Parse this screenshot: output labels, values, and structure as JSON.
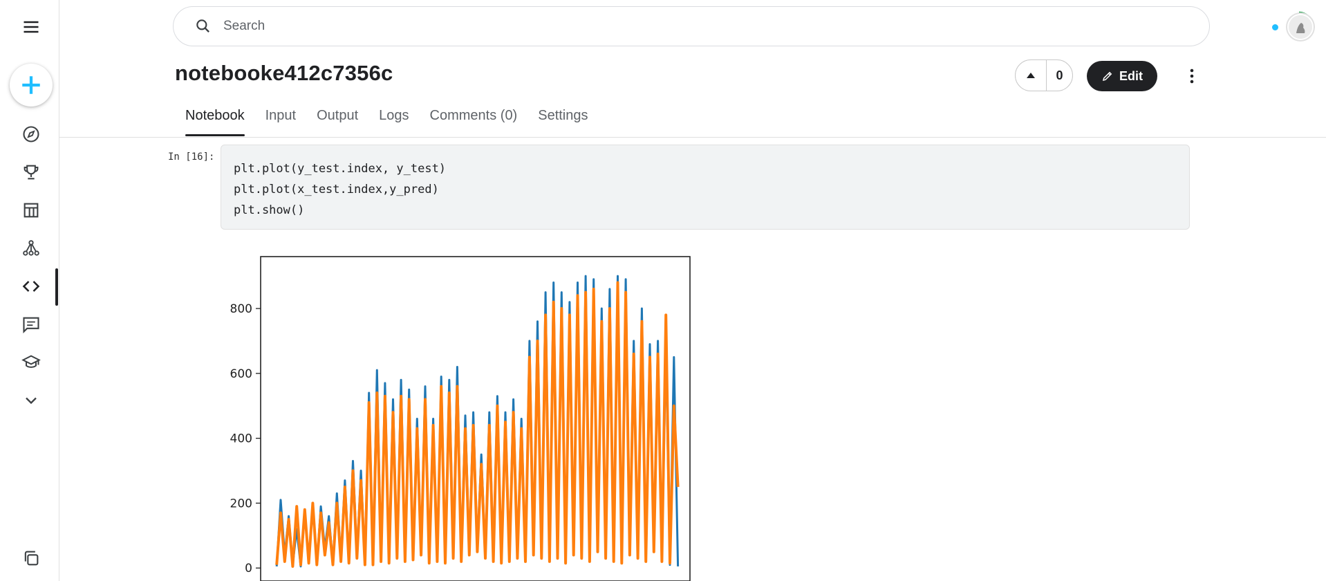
{
  "search": {
    "placeholder": "Search"
  },
  "notebook": {
    "title": "notebooke412c7356c",
    "votes": "0",
    "edit_label": "Edit"
  },
  "tabs": [
    {
      "label": "Notebook",
      "active": true
    },
    {
      "label": "Input"
    },
    {
      "label": "Output"
    },
    {
      "label": "Logs"
    },
    {
      "label": "Comments (0)"
    },
    {
      "label": "Settings"
    }
  ],
  "sidebar": {
    "icons": [
      "menu-icon",
      "create-icon",
      "compass-icon",
      "trophy-icon",
      "table-icon",
      "models-icon",
      "code-icon",
      "discussion-icon",
      "learn-icon",
      "chevron-down-icon",
      "copy-icon"
    ],
    "active": "code-icon"
  },
  "cell": {
    "prompt": "In [16]:",
    "code_lines": [
      "plt.plot(y_test.index, y_test)",
      "plt.plot(x_test.index,y_pred)",
      "plt.show()"
    ]
  },
  "colors": {
    "accent": "#20beff",
    "series1": "#1f77b4",
    "series2": "#ff7f0e"
  },
  "chart_data": {
    "type": "line",
    "y_ticks": [
      "0",
      "200",
      "400",
      "600",
      "800"
    ],
    "ylim": [
      -40,
      960
    ],
    "xlim": [
      -8,
      206
    ],
    "series": [
      {
        "color": "#1f77b4",
        "values": [
          5,
          210,
          40,
          160,
          10,
          120,
          5,
          170,
          20,
          200,
          10,
          190,
          60,
          160,
          15,
          230,
          30,
          270,
          20,
          330,
          40,
          300,
          15,
          540,
          10,
          610,
          30,
          570,
          20,
          520,
          40,
          580,
          25,
          550,
          30,
          460,
          50,
          560,
          20,
          460,
          30,
          590,
          20,
          580,
          40,
          620,
          30,
          470,
          50,
          480,
          60,
          350,
          40,
          480,
          30,
          530,
          20,
          480,
          30,
          520,
          40,
          460,
          30,
          700,
          50,
          760,
          40,
          850,
          30,
          880,
          40,
          850,
          20,
          820,
          50,
          880,
          40,
          900,
          30,
          890,
          60,
          800,
          40,
          860,
          30,
          900,
          20,
          890,
          50,
          700,
          40,
          800,
          30,
          690,
          60,
          700,
          30,
          680,
          10,
          650,
          5
        ]
      },
      {
        "color": "#ff7f0e",
        "values": [
          10,
          170,
          20,
          150,
          5,
          190,
          10,
          180,
          15,
          200,
          10,
          170,
          40,
          140,
          10,
          200,
          20,
          250,
          15,
          300,
          30,
          270,
          10,
          510,
          10,
          540,
          20,
          530,
          15,
          480,
          30,
          530,
          20,
          520,
          25,
          430,
          40,
          520,
          15,
          440,
          20,
          560,
          15,
          540,
          30,
          560,
          20,
          430,
          40,
          440,
          50,
          320,
          30,
          440,
          20,
          500,
          15,
          450,
          20,
          480,
          30,
          430,
          20,
          650,
          40,
          700,
          30,
          780,
          20,
          820,
          30,
          800,
          15,
          780,
          40,
          840,
          30,
          850,
          20,
          860,
          50,
          760,
          30,
          800,
          20,
          880,
          15,
          850,
          40,
          660,
          30,
          760,
          20,
          650,
          50,
          660,
          20,
          780,
          15,
          500,
          250
        ]
      }
    ]
  }
}
